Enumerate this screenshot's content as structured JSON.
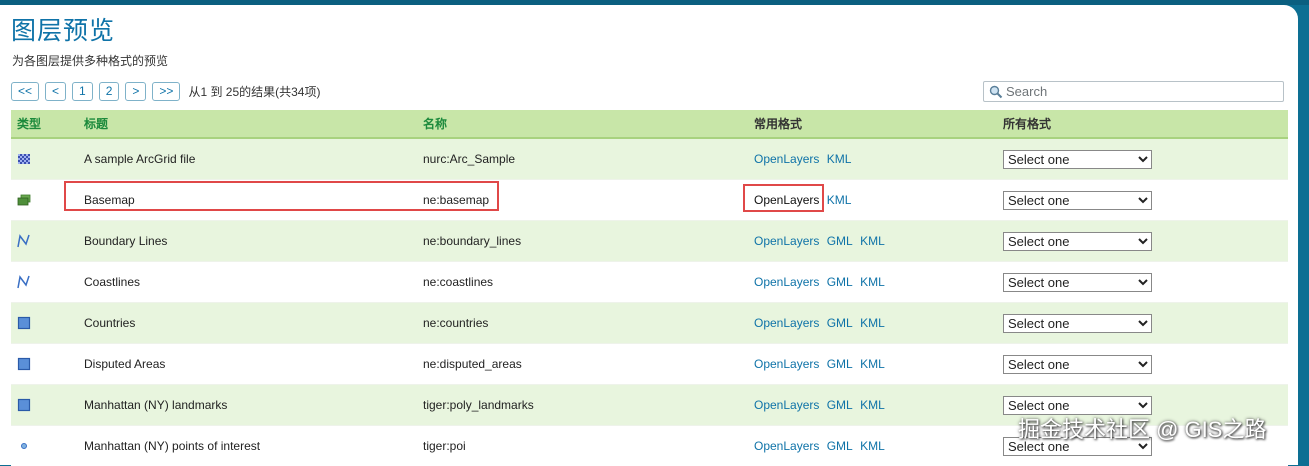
{
  "page": {
    "title": "图层预览",
    "subtitle": "为各图层提供多种格式的预览"
  },
  "pager": {
    "buttons": [
      "<<",
      "<",
      "1",
      "2",
      ">",
      ">>"
    ],
    "info": "从1 到 25的结果(共34项)"
  },
  "search": {
    "placeholder": "Search"
  },
  "table": {
    "headers": [
      "类型",
      "标题",
      "名称",
      "常用格式",
      "所有格式"
    ],
    "rows": [
      {
        "type_icon": "raster-icon",
        "title": "A sample ArcGrid file",
        "name": "nurc:Arc_Sample",
        "formats": [
          "OpenLayers",
          "KML"
        ],
        "select": "Select one"
      },
      {
        "type_icon": "layer-group-icon",
        "title": "Basemap",
        "name": "ne:basemap",
        "formats": [
          "OpenLayers",
          "KML"
        ],
        "select": "Select one"
      },
      {
        "type_icon": "line-icon",
        "title": "Boundary Lines",
        "name": "ne:boundary_lines",
        "formats": [
          "OpenLayers",
          "GML",
          "KML"
        ],
        "select": "Select one"
      },
      {
        "type_icon": "line-icon",
        "title": "Coastlines",
        "name": "ne:coastlines",
        "formats": [
          "OpenLayers",
          "GML",
          "KML"
        ],
        "select": "Select one"
      },
      {
        "type_icon": "polygon-icon",
        "title": "Countries",
        "name": "ne:countries",
        "formats": [
          "OpenLayers",
          "GML",
          "KML"
        ],
        "select": "Select one"
      },
      {
        "type_icon": "polygon-icon",
        "title": "Disputed Areas",
        "name": "ne:disputed_areas",
        "formats": [
          "OpenLayers",
          "GML",
          "KML"
        ],
        "select": "Select one"
      },
      {
        "type_icon": "polygon-icon",
        "title": "Manhattan (NY) landmarks",
        "name": "tiger:poly_landmarks",
        "formats": [
          "OpenLayers",
          "GML",
          "KML"
        ],
        "select": "Select one"
      },
      {
        "type_icon": "point-icon",
        "title": "Manhattan (NY) points of interest",
        "name": "tiger:poi",
        "formats": [
          "OpenLayers",
          "GML",
          "KML"
        ],
        "select": "Select one"
      }
    ]
  },
  "watermark": "掘金技术社区 @ GIS之路",
  "colors": {
    "header_bg": "#c8e6a8",
    "link": "#0f73a8",
    "highlight": "#e04848",
    "frame": "#0d6f93"
  }
}
